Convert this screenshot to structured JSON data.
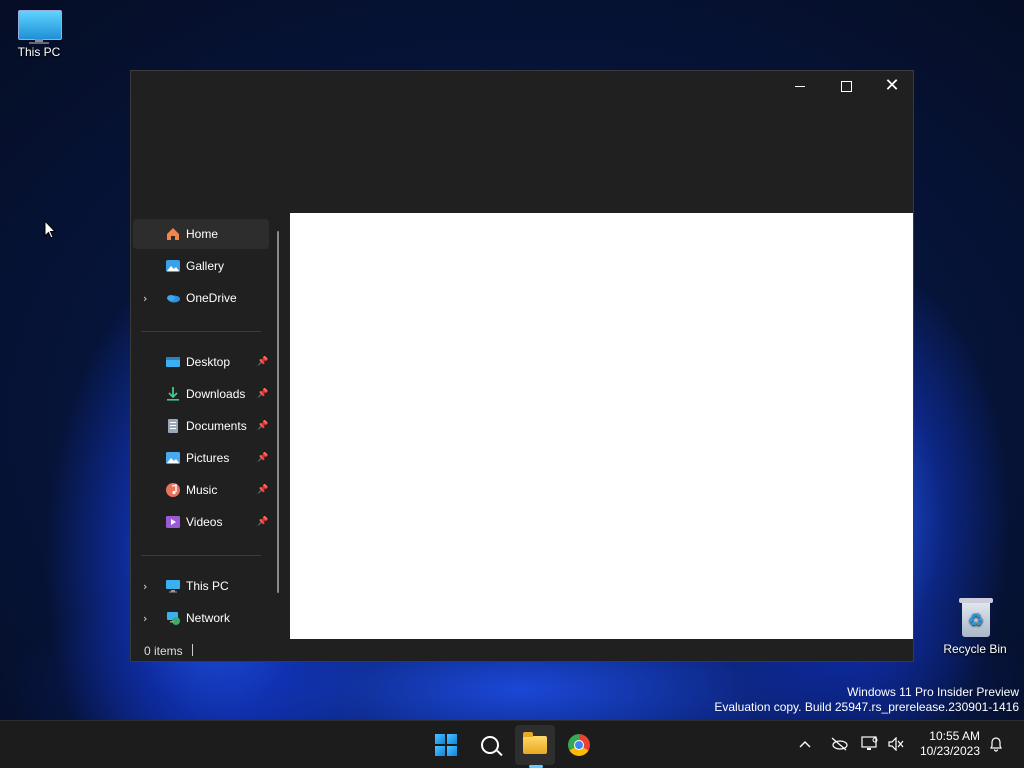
{
  "desktop": {
    "this_pc_label": "This PC",
    "recycle_bin_label": "Recycle Bin",
    "watermark_line1": "Windows 11 Pro Insider Preview",
    "watermark_line2": "Evaluation copy. Build 25947.rs_prerelease.230901-1416"
  },
  "window": {
    "minimize_icon": "minimize-icon",
    "maximize_icon": "maximize-icon",
    "close_icon": "close-icon",
    "close_glyph": "✕"
  },
  "sidebar": {
    "items": [
      {
        "label": "Home",
        "icon": "home-icon"
      },
      {
        "label": "Gallery",
        "icon": "gallery-icon"
      },
      {
        "label": "OneDrive",
        "icon": "onedrive-icon"
      },
      {
        "label": "Desktop",
        "icon": "desktop-icon"
      },
      {
        "label": "Downloads",
        "icon": "downloads-icon"
      },
      {
        "label": "Documents",
        "icon": "documents-icon"
      },
      {
        "label": "Pictures",
        "icon": "pictures-icon"
      },
      {
        "label": "Music",
        "icon": "music-icon"
      },
      {
        "label": "Videos",
        "icon": "videos-icon"
      },
      {
        "label": "This PC",
        "icon": "this-pc-icon"
      },
      {
        "label": "Network",
        "icon": "network-icon"
      }
    ]
  },
  "status": {
    "items_count": "0 items"
  },
  "taskbar": {
    "apps": [
      "start-icon",
      "search-icon",
      "file-explorer-icon",
      "chrome-icon"
    ],
    "clock_time": "10:55 AM",
    "clock_date": "10/23/2023"
  },
  "colors": {
    "accent": "#60cdff",
    "window_bg": "#202020",
    "content_bg": "#ffffff"
  }
}
